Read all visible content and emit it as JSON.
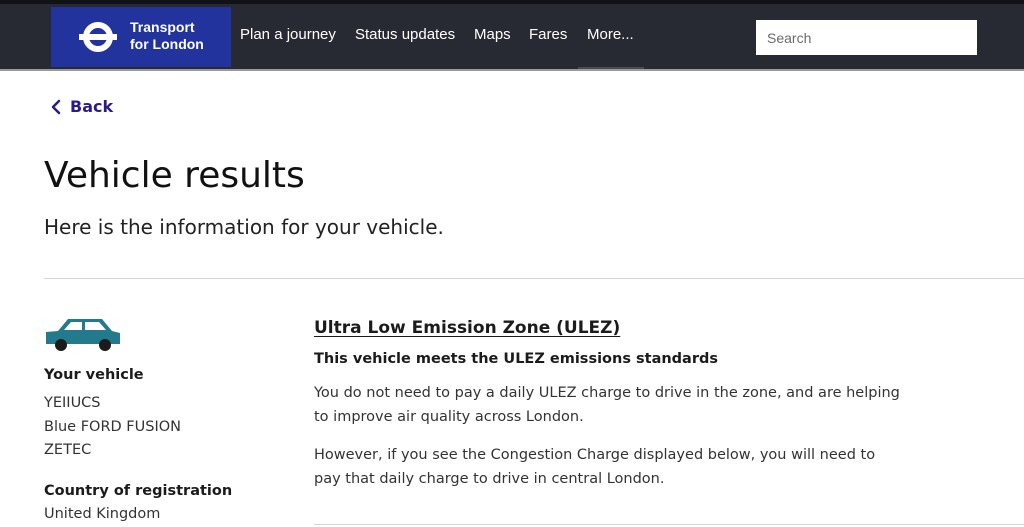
{
  "header": {
    "logo_line1": "Transport",
    "logo_line2": "for London",
    "nav": [
      "Plan a journey",
      "Status updates",
      "Maps",
      "Fares",
      "More..."
    ],
    "search_placeholder": "Search",
    "colors": {
      "bar": "#282a33",
      "logo_bg": "#23339e"
    }
  },
  "back_label": "Back",
  "page": {
    "title": "Vehicle results",
    "subtitle": "Here is the information for your vehicle."
  },
  "vehicle": {
    "icon": "car-icon",
    "icon_color": "#237a8c",
    "heading": "Your vehicle",
    "registration": "YEIIUCS",
    "make": "Blue FORD FUSION",
    "model": "ZETEC",
    "country_heading": "Country of registration",
    "country": "United Kingdom"
  },
  "ulez": {
    "title": "Ultra Low Emission Zone (ULEZ)",
    "status": "This vehicle meets the ULEZ emissions standards",
    "para1": "You do not need to pay a daily ULEZ charge to drive in the zone, and are helping to improve air quality across London.",
    "para2": "However, if you see the Congestion Charge displayed below, you will need to pay that daily charge to drive in central London."
  }
}
